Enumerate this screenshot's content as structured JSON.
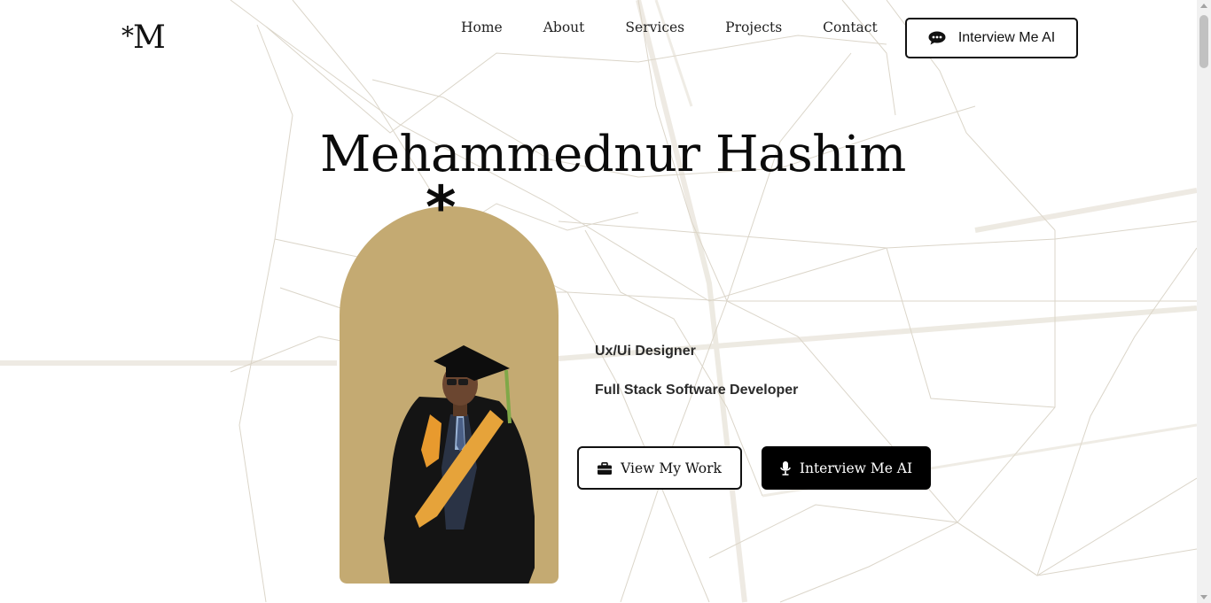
{
  "header": {
    "logo_mark": "*",
    "logo_letter": "M",
    "nav": [
      "Home",
      "About",
      "Services",
      "Projects",
      "Contact"
    ],
    "cta_label": "Interview Me AI",
    "cta_icon": "chat-bubble-icon"
  },
  "hero": {
    "name": "Mehammednur Hashim",
    "decorative_mark": "*",
    "roles": [
      "Ux/Ui Designer",
      "Full Stack Software Developer"
    ],
    "photo_alt": "graduation portrait",
    "buttons": {
      "view_work": {
        "label": "View My Work",
        "icon": "briefcase-icon"
      },
      "interview": {
        "label": "Interview Me AI",
        "icon": "microphone-icon"
      }
    }
  },
  "colors": {
    "accent": "#c4aa72",
    "text": "#0b0b0b",
    "button_dark": "#000000",
    "line": "#d8d2c4"
  }
}
